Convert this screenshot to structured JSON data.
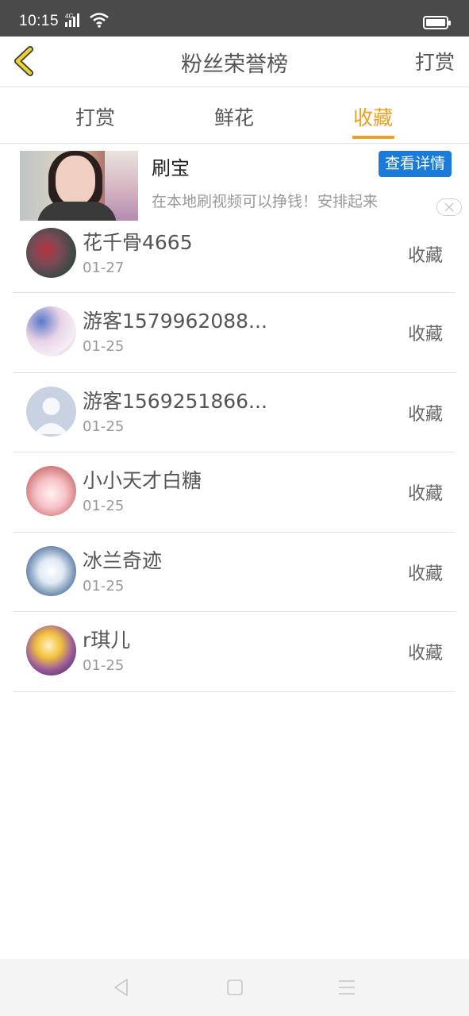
{
  "status_bar": {
    "time": "10:15",
    "network": "4G"
  },
  "nav": {
    "title": "粉丝荣誉榜",
    "action_label": "打赏",
    "back_icon": "chevron-left-icon"
  },
  "tabs": [
    {
      "label": "打赏",
      "active": false
    },
    {
      "label": "鲜花",
      "active": false
    },
    {
      "label": "收藏",
      "active": true
    }
  ],
  "ad": {
    "title": "刷宝",
    "description": "在本地刷视频可以挣钱！安排起来",
    "cta_label": "查看详情"
  },
  "fans": [
    {
      "name": "花千骨4665",
      "date": "01-27",
      "action": "收藏"
    },
    {
      "name": "游客1579962088...",
      "date": "01-25",
      "action": "收藏"
    },
    {
      "name": "游客1569251866...",
      "date": "01-25",
      "action": "收藏"
    },
    {
      "name": "小小天才白糖",
      "date": "01-25",
      "action": "收藏"
    },
    {
      "name": "冰兰奇迹",
      "date": "01-25",
      "action": "收藏"
    },
    {
      "name": "r琪儿",
      "date": "01-25",
      "action": "收藏"
    }
  ],
  "colors": {
    "accent": "#f0a020",
    "status_bar": "#4a4a4a",
    "cta_blue": "#1c7bd9"
  }
}
